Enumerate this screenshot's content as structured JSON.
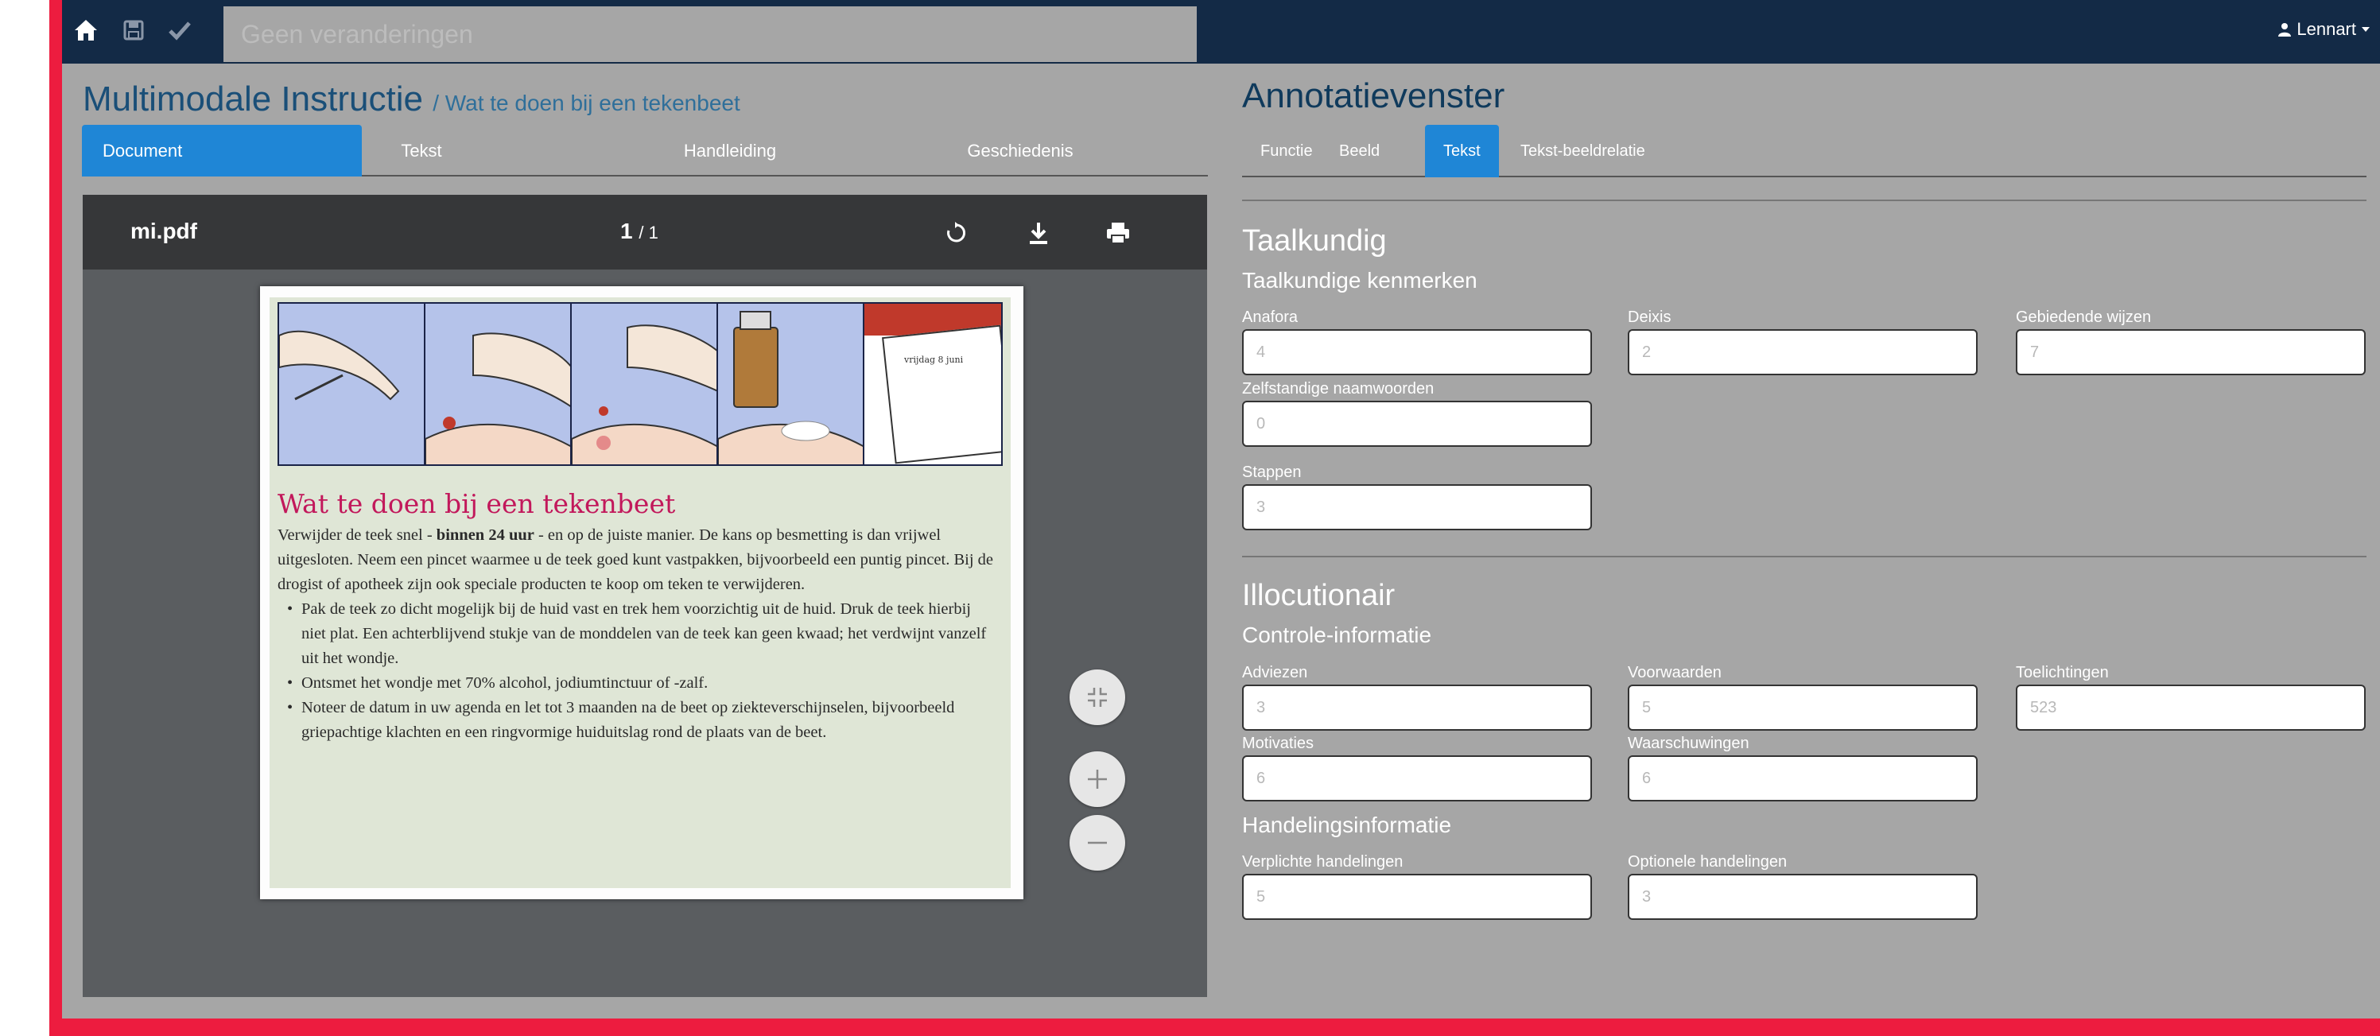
{
  "navbar": {
    "status": "Geen veranderingen",
    "user": "Lennart"
  },
  "left": {
    "title": "Multimodale Instructie",
    "subtitle": "/ Wat te doen bij een tekenbeet",
    "tabs": [
      "Document",
      "Tekst",
      "Handleiding",
      "Geschiedenis"
    ]
  },
  "pdf": {
    "filename": "mi.pdf",
    "page_current": "1",
    "page_total": "/ 1",
    "comic_label": "vrijdag 8 juni",
    "doc_title": "Wat te doen bij een tekenbeet",
    "intro_pre": "Verwijder de teek snel - ",
    "intro_bold": "binnen 24 uur",
    "intro_post": " - en op de juiste manier. De kans op besmetting is dan vrijwel uitgesloten. Neem een pincet waarmee u de teek goed kunt vastpakken, bijvoorbeeld een puntig pincet. Bij de drogist of apotheek zijn ook speciale producten te koop om teken te verwijderen.",
    "bullets": [
      "Pak de teek zo dicht mogelijk bij de huid vast en trek hem voorzichtig uit de huid. Druk de teek hierbij niet plat. Een achterblijvend stukje van de monddelen van de teek kan geen kwaad; het verdwijnt vanzelf uit het wondje.",
      "Ontsmet het wondje met 70% alcohol, jodiumtinctuur of -zalf.",
      "Noteer de datum in uw agenda en let tot 3 maanden na de beet op ziekteverschijnselen, bijvoorbeeld griepachtige klachten en een ringvormige huiduitslag rond de plaats van de beet."
    ]
  },
  "right": {
    "title": "Annotatievenster",
    "tabs": [
      "Functie",
      "Beeld",
      "Tekst",
      "Tekst-beeldrelatie"
    ],
    "taalkundig": {
      "heading": "Taalkundig",
      "sub": "Taalkundige kenmerken",
      "fields": [
        {
          "label": "Anafora",
          "value": "4"
        },
        {
          "label": "Deixis",
          "value": "2"
        },
        {
          "label": "Gebiedende wijzen",
          "value": "7"
        },
        {
          "label": "Zelfstandige naamwoorden",
          "value": "0"
        },
        {
          "label": "Stappen",
          "value": "3"
        }
      ]
    },
    "illocutionair": {
      "heading": "Illocutionair",
      "controle": {
        "sub": "Controle-informatie",
        "fields": [
          {
            "label": "Adviezen",
            "value": "3"
          },
          {
            "label": "Voorwaarden",
            "value": "5"
          },
          {
            "label": "Toelichtingen",
            "value": "523"
          },
          {
            "label": "Motivaties",
            "value": "6"
          },
          {
            "label": "Waarschuwingen",
            "value": "6"
          }
        ]
      },
      "handeling": {
        "sub": "Handelingsinformatie",
        "fields": [
          {
            "label": "Verplichte handelingen",
            "value": "5"
          },
          {
            "label": "Optionele handelingen",
            "value": "3"
          }
        ]
      }
    }
  }
}
